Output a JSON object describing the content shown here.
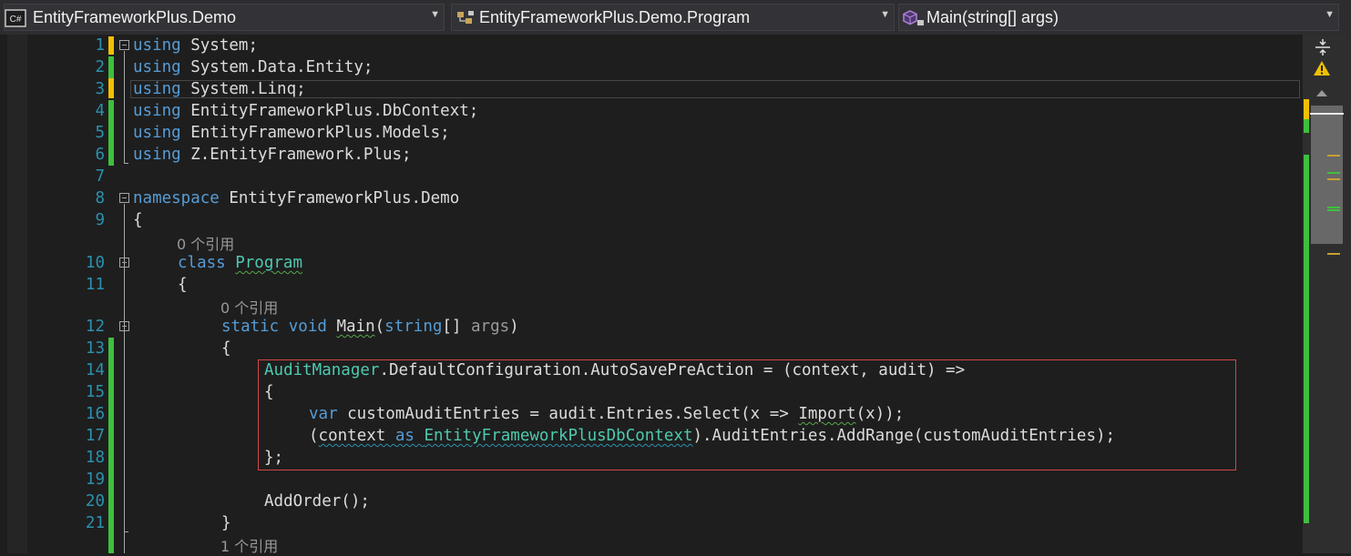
{
  "navbar": {
    "project": {
      "label": "EntityFrameworkPlus.Demo",
      "icon": "csharp-project-icon"
    },
    "type": {
      "label": "EntityFrameworkPlus.Demo.Program",
      "icon": "class-icon"
    },
    "member": {
      "label": "Main(string[] args)",
      "icon": "method-icon"
    }
  },
  "editor": {
    "line_numbers": [
      "1",
      "2",
      "3",
      "4",
      "5",
      "6",
      "7",
      "8",
      "9",
      "10",
      "11",
      "12",
      "13",
      "14",
      "15",
      "16",
      "17",
      "18",
      "19",
      "20",
      "21"
    ],
    "lines": {
      "l1": {
        "kw": "using",
        "rest": " System;"
      },
      "l2": {
        "kw": "using",
        "rest": " System.Data.Entity;"
      },
      "l3": {
        "kw": "using",
        "rest": " System.Linq;"
      },
      "l4": {
        "kw": "using",
        "rest": " EntityFrameworkPlus.DbContext;"
      },
      "l5": {
        "kw": "using",
        "rest": " EntityFrameworkPlus.Models;"
      },
      "l6": {
        "kw": "using",
        "rest": " Z.EntityFramework.Plus;"
      },
      "l8": {
        "kw": "namespace",
        "rest": " EntityFrameworkPlus.Demo"
      },
      "l9": {
        "text": "{"
      },
      "l10": {
        "kw": "class",
        "sp": " ",
        "name": "Program"
      },
      "l11": {
        "text": "{"
      },
      "l12": {
        "kw1": "static",
        "sp1": " ",
        "kw2": "void",
        "sp2": " ",
        "name": "Main",
        "open": "(",
        "kw3": "string",
        "mid": "[] ",
        "param": "args",
        "close": ")"
      },
      "l13": {
        "text": "{"
      },
      "l14": {
        "type": "AuditManager",
        "rest": ".DefaultConfiguration.AutoSavePreAction = (context, audit) =>"
      },
      "l15": {
        "text": "{"
      },
      "l16": {
        "kw": "var",
        "a": " customAuditEntries = audit.Entries.Select(x => ",
        "call": "Import",
        "b": "(x));"
      },
      "l17": {
        "open": "(",
        "err1": "context ",
        "kw": "as",
        "sp": " ",
        "err2": "EntityFrameworkPlusDbContext",
        "rest": ").AuditEntries.AddRange(customAuditEntries);"
      },
      "l18": {
        "text": "};"
      },
      "l20": {
        "text": "AddOrder();"
      },
      "l21": {
        "text": "}"
      }
    },
    "codelens": {
      "class": "0 个引用",
      "main": "0 个引用",
      "next": "1 个引用"
    }
  },
  "scrollbar": {
    "icons": [
      "split-view-icon",
      "warning-icon",
      "scroll-up-arrow-icon"
    ]
  },
  "colors": {
    "background": "#1e1e1e",
    "keyword": "#569cd6",
    "type": "#4ec9b0",
    "line_number": "#2b91af",
    "change_saved": "#3fbf3f",
    "change_unsaved": "#f0c000",
    "highlight_box": "#d64545"
  }
}
